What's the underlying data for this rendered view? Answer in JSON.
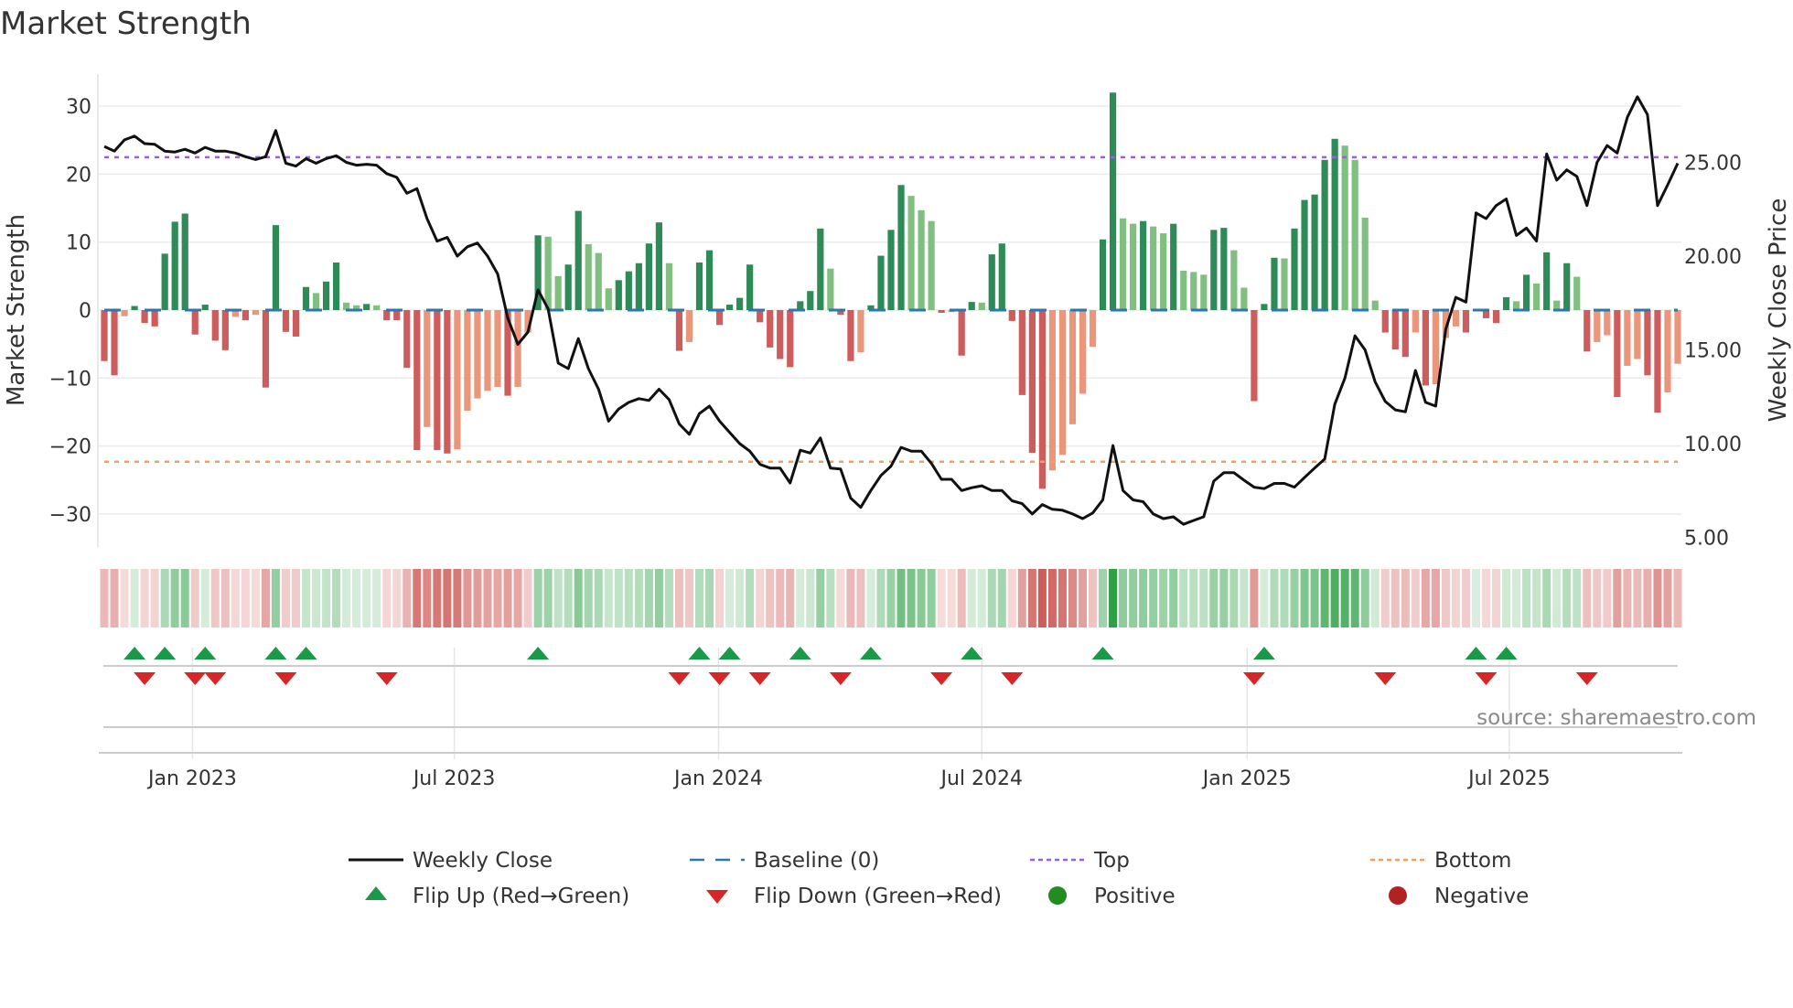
{
  "chart_data": {
    "type": "bar",
    "title": "Market Strength",
    "ylabel": "Market Strength",
    "y2label": "Weekly Close Price",
    "ylim": [
      -32,
      35
    ],
    "y2lim": [
      4.4,
      29.6
    ],
    "yticks": [
      "30",
      "20",
      "10",
      "0",
      "−10",
      "−20",
      "−30"
    ],
    "ytick_values": [
      30,
      20,
      10,
      0,
      -10,
      -20,
      -30
    ],
    "y2ticks": [
      "25.00",
      "20.00",
      "15.00",
      "10.00",
      "5.00"
    ],
    "y2tick_values": [
      25,
      20,
      15,
      10,
      5
    ],
    "xticks": [
      {
        "label": "Jan 2023",
        "week": 8.75
      },
      {
        "label": "Jul 2023",
        "week": 34.7
      },
      {
        "label": "Jan 2024",
        "week": 60.9
      },
      {
        "label": "Jul 2024",
        "week": 87.0
      },
      {
        "label": "Jan 2025",
        "week": 113.3
      },
      {
        "label": "Jul 2025",
        "week": 139.3
      }
    ],
    "top_level": 22.5,
    "bottom_level": -22.3,
    "strength": [
      -7.5,
      -9.6,
      -0.9,
      0.6,
      -1.9,
      -2.4,
      8.3,
      13,
      14.2,
      -3.6,
      0.8,
      -4.5,
      -5.9,
      -1,
      -1.5,
      -0.7,
      -11.4,
      12.5,
      -3.2,
      -3.9,
      3.4,
      2.5,
      4.2,
      7,
      1.1,
      0.7,
      0.9,
      0.7,
      -1.5,
      -1.5,
      -8.5,
      -20.6,
      -17.2,
      -20.6,
      -21.1,
      -20.5,
      -14.8,
      -13,
      -11.9,
      -11.3,
      -12.6,
      -11.3,
      -3.3,
      11,
      10.8,
      5,
      6.7,
      14.6,
      9.7,
      8.4,
      3.2,
      4.4,
      5.7,
      6.9,
      9.8,
      12.9,
      6.9,
      -6,
      -4.7,
      7,
      8.8,
      -2.2,
      0.8,
      1.8,
      6.7,
      -1.8,
      -5.5,
      -7.2,
      -8.4,
      1.3,
      2.8,
      12,
      6.1,
      -0.7,
      -7.5,
      -6.2,
      0.7,
      8,
      11.8,
      18.4,
      16.8,
      14.7,
      13.1,
      -0.4,
      -0.3,
      -6.7,
      1.2,
      1.1,
      8.2,
      9.8,
      -1.6,
      -12.5,
      -21,
      -26.3,
      -23.6,
      -21.3,
      -16.8,
      -12.3,
      -5.4,
      10.4,
      32,
      13.5,
      12.7,
      13.1,
      12.3,
      11.3,
      12.7,
      5.8,
      5.6,
      5.2,
      11.8,
      12.1,
      8.8,
      3.3,
      -13.4,
      0.9,
      7.7,
      7.6,
      12,
      16.2,
      17,
      22.1,
      25.2,
      24.2,
      22.1,
      13.6,
      1.4,
      -3.3,
      -5.8,
      -6.9,
      -3.3,
      -11.1,
      -10.9,
      -4.1,
      -2.4,
      -3.3,
      0,
      -1.2,
      -1.9,
      1.9,
      1.3,
      5.2,
      3.9,
      8.5,
      1.4,
      6.9,
      4.9,
      -6.1,
      -4.7,
      -3.7,
      -12.8,
      -8.2,
      -7.2,
      -9.6,
      -15.1,
      -12.1,
      -7.9
    ],
    "weekly_close": [
      25.85,
      25.6,
      26.2,
      26.4,
      26.0,
      25.96,
      25.6,
      25.55,
      25.7,
      25.5,
      25.8,
      25.6,
      25.6,
      25.5,
      25.3,
      25.15,
      25.3,
      26.7,
      24.95,
      24.8,
      25.2,
      24.95,
      25.2,
      25.35,
      25.0,
      24.85,
      24.9,
      24.85,
      24.4,
      24.2,
      23.35,
      23.6,
      22.0,
      20.8,
      21.0,
      20.0,
      20.5,
      20.7,
      20.0,
      19.05,
      16.7,
      15.3,
      15.95,
      18.2,
      17.2,
      14.3,
      14.0,
      15.6,
      14.0,
      12.9,
      11.2,
      11.85,
      12.2,
      12.4,
      12.3,
      12.9,
      12.35,
      11.05,
      10.5,
      11.6,
      12.0,
      11.2,
      10.6,
      10.0,
      9.6,
      8.9,
      8.7,
      8.7,
      7.9,
      9.65,
      9.5,
      10.3,
      8.7,
      8.65,
      7.1,
      6.6,
      7.5,
      8.3,
      8.8,
      9.8,
      9.6,
      9.6,
      8.95,
      8.1,
      8.1,
      7.5,
      7.65,
      7.75,
      7.5,
      7.5,
      6.95,
      6.8,
      6.25,
      6.75,
      6.5,
      6.45,
      6.25,
      6.0,
      6.3,
      7.0,
      9.9,
      7.5,
      7.0,
      6.9,
      6.25,
      6.0,
      6.1,
      5.7,
      5.9,
      6.1,
      8.0,
      8.45,
      8.45,
      8.05,
      7.68,
      7.6,
      7.88,
      7.88,
      7.68,
      8.2,
      8.7,
      9.18,
      12.1,
      13.5,
      15.75,
      15.0,
      13.3,
      12.25,
      11.8,
      11.7,
      13.9,
      12.2,
      12.0,
      16.1,
      17.8,
      17.55,
      22.3,
      22.0,
      22.7,
      23.05,
      21.1,
      21.5,
      20.8,
      25.45,
      24.05,
      24.6,
      24.25,
      22.7,
      25.0,
      25.9,
      25.5,
      27.4,
      28.5,
      27.55,
      22.7,
      23.8,
      24.95
    ],
    "flip_up_weeks": [
      3,
      6,
      10,
      17,
      20,
      43,
      59,
      62,
      69,
      76,
      86,
      99,
      115,
      136,
      139
    ],
    "flip_down_weeks": [
      4,
      9,
      11,
      18,
      28,
      57,
      61,
      65,
      73,
      83,
      90,
      114,
      127,
      137,
      147
    ],
    "legend": {
      "placement": "bottom",
      "items": [
        {
          "key": "close",
          "label": "Weekly Close"
        },
        {
          "key": "baseline",
          "label": "Baseline (0)"
        },
        {
          "key": "top",
          "label": "Top"
        },
        {
          "key": "bottom",
          "label": "Bottom"
        },
        {
          "key": "flip_up",
          "label": "Flip Up (Red→Green)"
        },
        {
          "key": "flip_down",
          "label": "Flip Down (Green→Red)"
        },
        {
          "key": "positive",
          "label": "Positive"
        },
        {
          "key": "negative",
          "label": "Negative"
        }
      ]
    },
    "source": "source: sharemaestro.com",
    "grid": true
  },
  "colors": {
    "pos_strong": "#2e8b57",
    "pos_weak": "#80bf80",
    "neg_strong": "#cd5c5c",
    "neg_weak": "#e9967a",
    "close": "#111111",
    "baseline": "#2a78b0",
    "top": "#9b5fe0",
    "bottom": "#f0a060",
    "flip_up": "#1a9a48",
    "flip_down": "#d62728",
    "positive": "#228b22",
    "negative": "#b22222",
    "grid": "#ebebeb"
  }
}
